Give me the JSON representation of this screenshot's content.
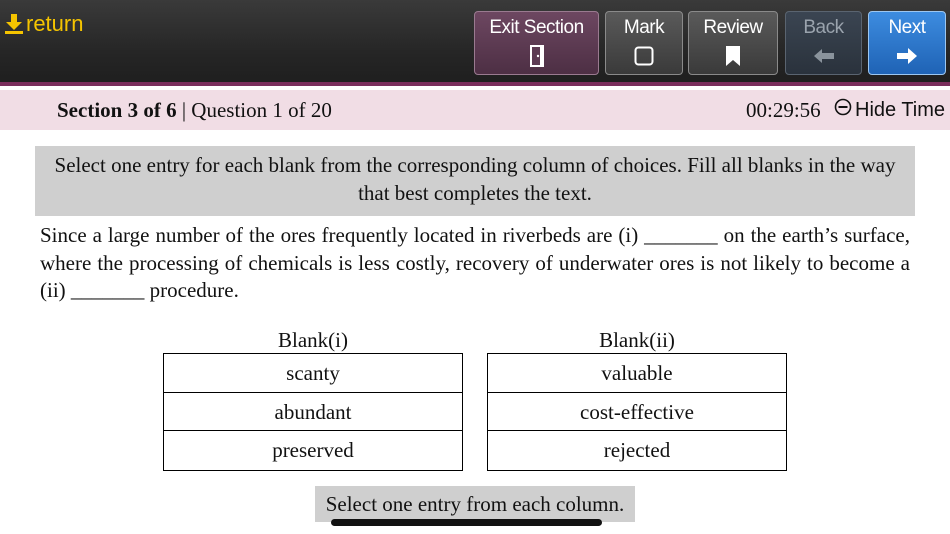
{
  "toolbar": {
    "return_label": "return",
    "buttons": {
      "exit_section": "Exit Section",
      "mark": "Mark",
      "review": "Review",
      "back": "Back",
      "next": "Next"
    },
    "icons": {
      "return": "download-arrow-icon",
      "exit_section": "door-icon",
      "mark": "checkbox-icon",
      "review": "bookmark-icon",
      "back": "arrow-left-icon",
      "next": "arrow-right-icon"
    },
    "colors": {
      "return_text": "#f5c400",
      "exit_bg": "#5d3b53",
      "next_bg": "#2e78cc",
      "accent_stripe": "#7a2d5c"
    }
  },
  "section_bar": {
    "section_label": "Section 3 of 6",
    "question_label": "Question 1 of 20",
    "timer": "00:29:56",
    "hide_time_label": "Hide Time"
  },
  "instructions": "Select one entry for each blank from the corresponding column of choices. Fill all blanks in the way that best completes the text.",
  "passage": "Since a large number of the ores frequently located in riverbeds are (i) _______ on the earth’s surface, where the processing of chemicals is less costly, recovery of underwater ores is not likely to become a (ii) _______ procedure.",
  "blanks": [
    {
      "header": "Blank(i)",
      "choices": [
        "scanty",
        "abundant",
        "preserved"
      ]
    },
    {
      "header": "Blank(ii)",
      "choices": [
        "valuable",
        "cost-effective",
        "rejected"
      ]
    }
  ],
  "bottom_prompt": "Select one entry from each column."
}
